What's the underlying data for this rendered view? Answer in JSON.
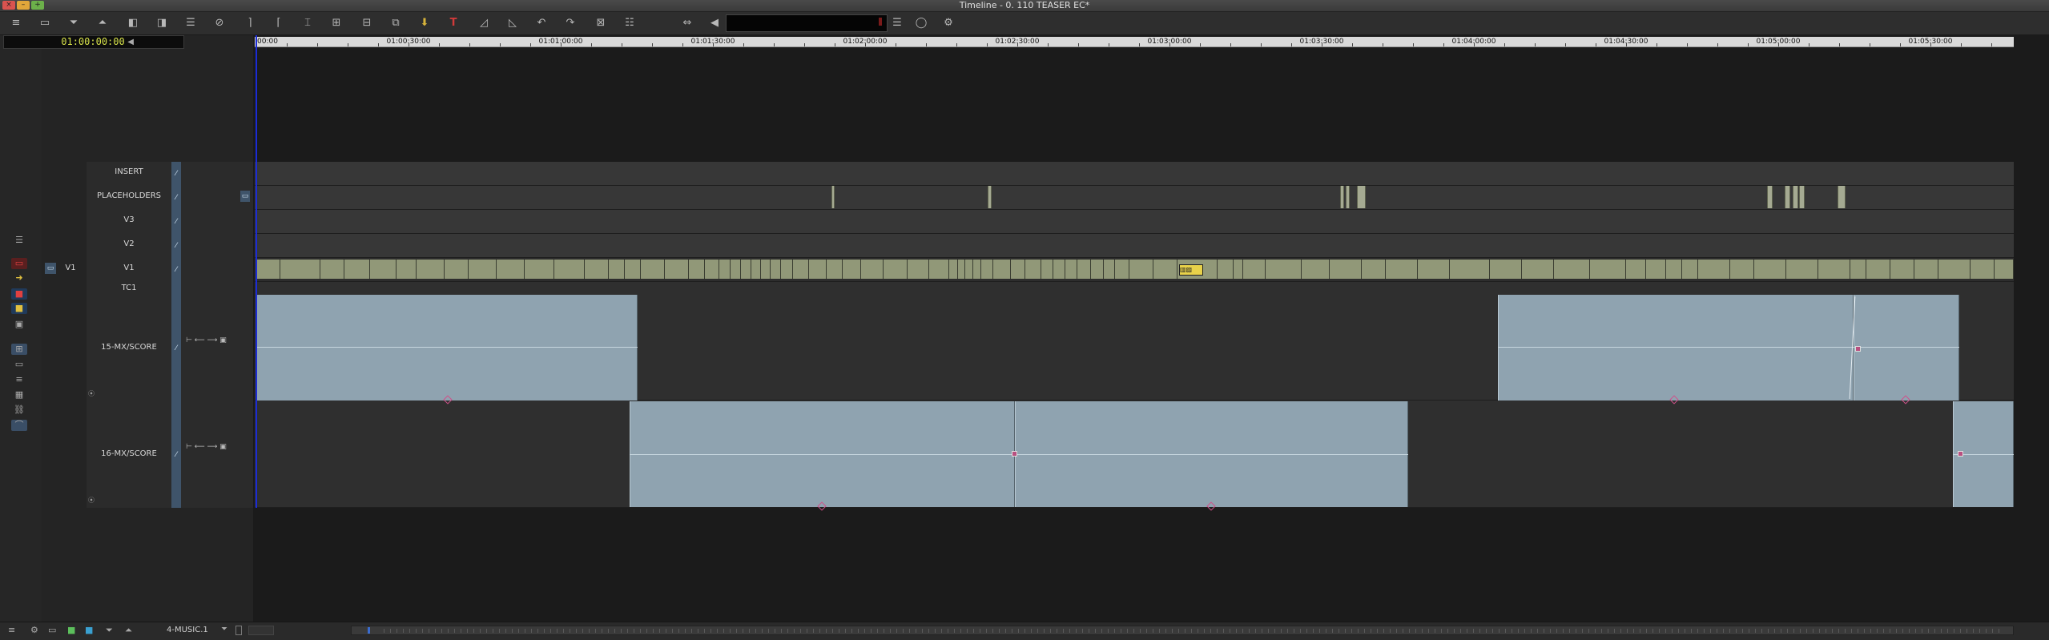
{
  "window": {
    "title": "Timeline - 0. 110 TEASER EC*",
    "close": "×",
    "minimize": "–",
    "zoom": "+"
  },
  "toolbar": {
    "icons": [
      "menu-icon",
      "bin-icon",
      "lower-icon",
      "lift-icon",
      "extract-icon",
      "overwrite-icon",
      "audio-mix-icon",
      "no-entry-icon",
      "mark-in-icon",
      "mark-out-icon",
      "mark-clip-icon",
      "clear-marks-icon",
      "segment-icon",
      "splice-icon",
      "add-marker-icon",
      "red-mark-icon",
      "trim-left-icon",
      "trim-right-icon",
      "rewind-icon",
      "step-back-icon",
      "link-icon",
      "list-icon",
      "sync-icon",
      "speaker-icon",
      "settings-icon"
    ]
  },
  "timecode": {
    "master": "01:00:00:00"
  },
  "ruler": {
    "labels": [
      "00:00",
      "01:00:30:00",
      "01:01:00:00",
      "01:01:30:00",
      "01:02:00:00",
      "01:02:30:00",
      "01:03:00:00",
      "01:03:30:00",
      "01:04:00:00",
      "01:04:30:00",
      "01:05:00:00",
      "01:05:30:00"
    ]
  },
  "tracks": {
    "insert": "INSERT",
    "placeholders": "PLACEHOLDERS",
    "v3": "V3",
    "v2": "V2",
    "v1": "V1",
    "v1_source": "V1",
    "tc1": "TC1",
    "a15": "15-MX/SCORE",
    "a16": "16-MX/SCORE"
  },
  "bottom": {
    "sequence": "4-MUSIC.1"
  },
  "colors": {
    "playhead": "#1b2bd6",
    "timecode": "#d7e24a",
    "video_clip": "#919878",
    "audio_clip": "#8fa3b0",
    "lock": "#3f546a"
  }
}
